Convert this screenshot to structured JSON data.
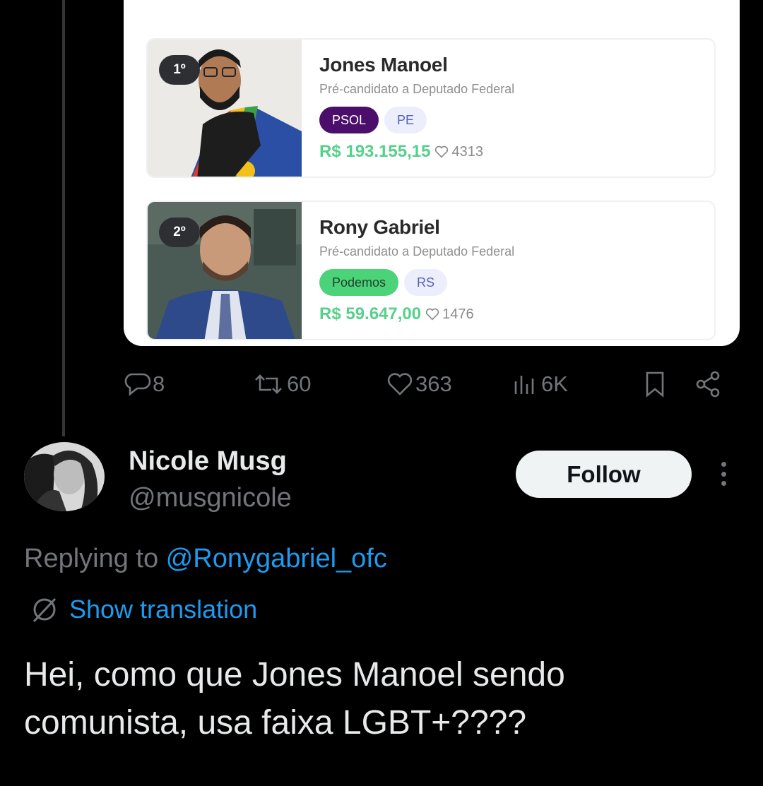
{
  "media": {
    "candidates": [
      {
        "rank": "1º",
        "name": "Jones Manoel",
        "role": "Pré-candidato a Deputado Federal",
        "party": "PSOL",
        "state": "PE",
        "amount": "R$ 193.155,15",
        "likes": "4313",
        "party_color": "#4b0f6b"
      },
      {
        "rank": "2º",
        "name": "Rony Gabriel",
        "role": "Pré-candidato a Deputado Federal",
        "party": "Podemos",
        "state": "RS",
        "amount": "R$ 59.647,00",
        "likes": "1476",
        "party_color": "#4cd37a"
      }
    ]
  },
  "actions": {
    "replies": "8",
    "retweets": "60",
    "likes": "363",
    "views": "6K"
  },
  "reply": {
    "author_name": "Nicole Musg",
    "author_handle": "@musgnicole",
    "follow_label": "Follow",
    "replying_prefix": "Replying to ",
    "replying_mention": "@Ronygabriel_ofc",
    "translate_label": "Show translation",
    "text": "Hei, como que Jones Manoel sendo comunista, usa faixa LGBT+????"
  },
  "colors": {
    "background": "#000000",
    "link": "#1d9bf0",
    "muted": "#71767b",
    "money": "#56d08a"
  }
}
